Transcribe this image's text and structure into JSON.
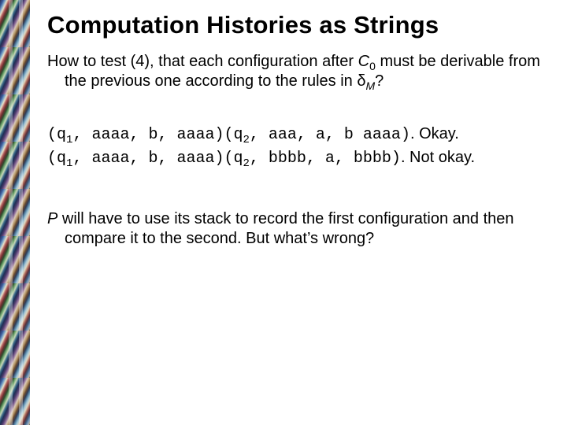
{
  "slide": {
    "title": "Computation Histories as Strings",
    "intro": {
      "lead": "How to test (4), that each configuration after ",
      "c": "C",
      "csub": "0",
      "mid": " must be derivable from the previous one according to the rules in ",
      "delta": "δ",
      "dsub": "M",
      "tail": "?"
    },
    "ex1": {
      "open1": "(",
      "q1": "q",
      "q1sub": "1",
      "seg1": ", aaaa, b, aaaa)(",
      "q2": "q",
      "q2sub": "2",
      "seg2": ", aaa, a, b aaaa)",
      "verdict": ".  Okay."
    },
    "ex2": {
      "open1": "(",
      "q1": "q",
      "q1sub": "1",
      "seg1": ", aaaa, b, aaaa)(",
      "q2": "q",
      "q2sub": "2",
      "seg2": ", bbbb, a, bbbb)",
      "verdict": ".  Not okay."
    },
    "closing": {
      "p": "P",
      "rest": " will have to use its stack to record the first configuration and then compare it to the second.  But what’s wrong?"
    }
  }
}
